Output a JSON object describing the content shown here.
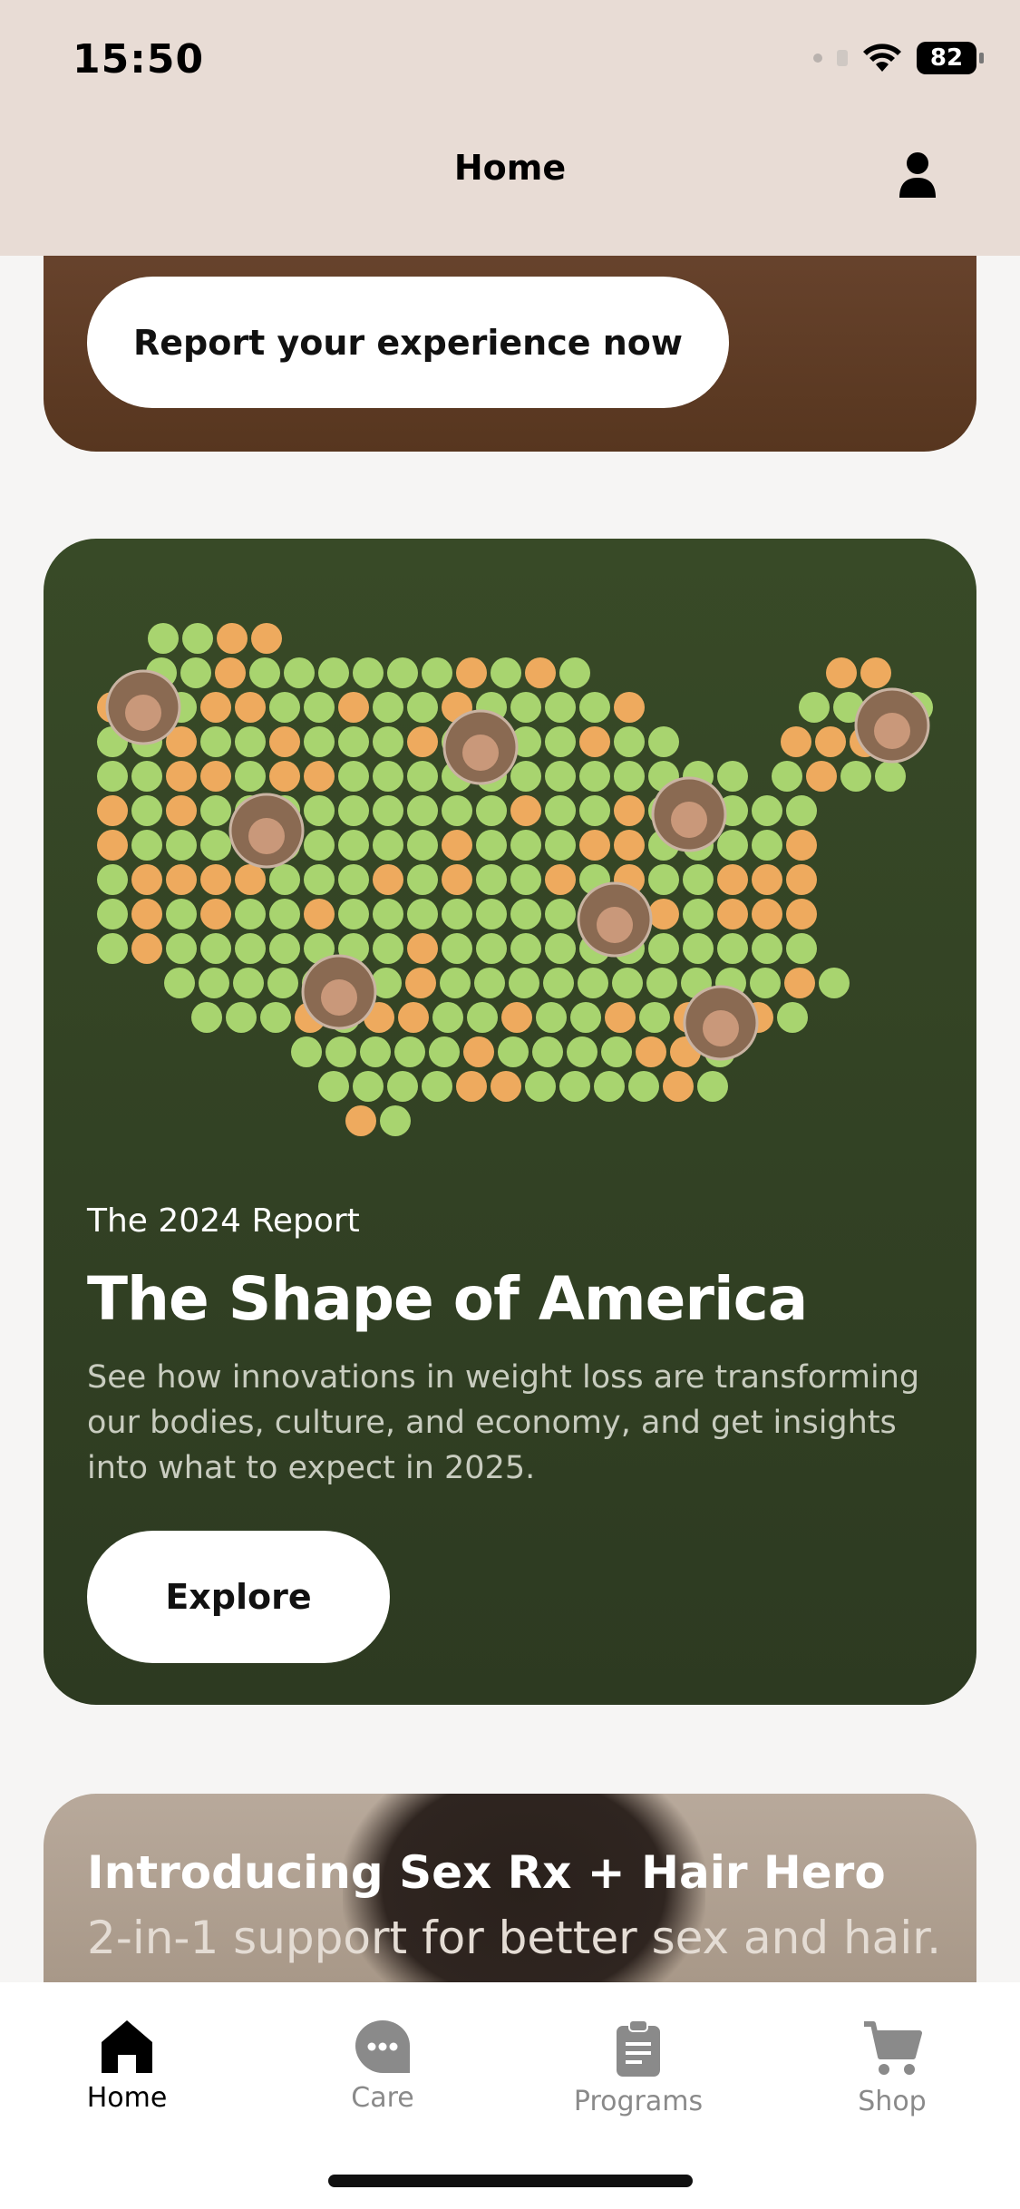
{
  "status_bar": {
    "time": "15:50",
    "battery": "82"
  },
  "header": {
    "title": "Home",
    "profile_icon": "person-icon"
  },
  "feedback_card": {
    "button_label": "Report your experience now",
    "background": "#5f3d27"
  },
  "report_card": {
    "eyebrow": "The 2024 Report",
    "title": "The Shape of America",
    "description": "See how innovations in weight loss are transforming our bodies, culture, and economy, and get insights into what to expect in 2025.",
    "button_label": "Explore",
    "background": "#33442a",
    "map_colors": {
      "green": "#a8d46f",
      "orange": "#eeaa5e"
    }
  },
  "promo_card": {
    "title": "Introducing Sex Rx + Hair Hero",
    "subtitle": "2-in-1 support for better sex and hair."
  },
  "tab_bar": {
    "tabs": [
      {
        "label": "Home",
        "icon": "home-icon",
        "active": true
      },
      {
        "label": "Care",
        "icon": "chat-bubble-icon",
        "active": false
      },
      {
        "label": "Programs",
        "icon": "clipboard-icon",
        "active": false
      },
      {
        "label": "Shop",
        "icon": "cart-icon",
        "active": false
      }
    ]
  }
}
